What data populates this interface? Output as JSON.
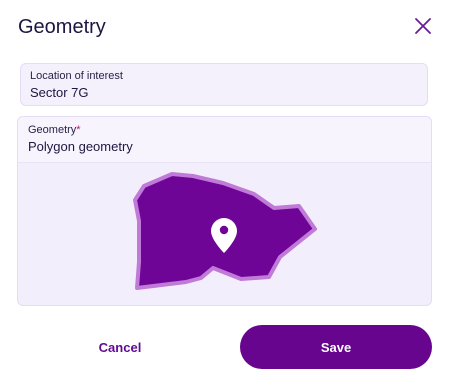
{
  "dialog": {
    "title": "Geometry",
    "close_icon": "close-icon"
  },
  "location": {
    "label": "Location of interest",
    "value": "Sector 7G"
  },
  "geometry": {
    "label": "Geometry",
    "required_marker": "*",
    "value": "Polygon geometry",
    "shape": "polygon",
    "pin_icon": "map-pin-icon"
  },
  "actions": {
    "cancel_label": "Cancel",
    "save_label": "Save"
  },
  "colors": {
    "accent": "#68058f",
    "polygon_fill": "#6f0596",
    "polygon_outline": "#c07ad8",
    "panel": "#f3eefb",
    "required": "#c0147a"
  }
}
